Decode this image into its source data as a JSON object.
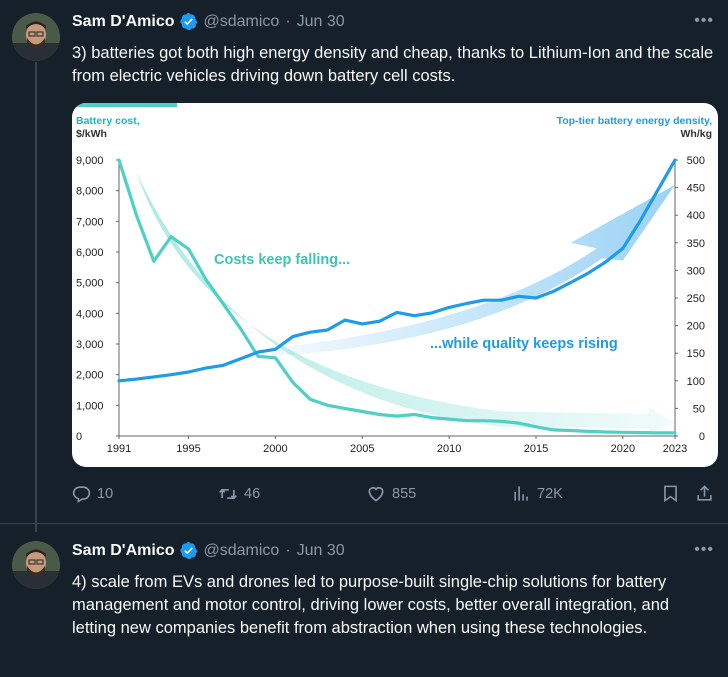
{
  "tweets": [
    {
      "author_name": "Sam D'Amico",
      "handle": "@sdamico",
      "separator": "·",
      "date": "Jun 30",
      "text": "3) batteries got both high energy density and cheap, thanks to Lithium-Ion and the scale from electric vehicles driving down battery cell costs.",
      "stats": {
        "replies": "10",
        "retweets": "46",
        "likes": "855",
        "views": "72K"
      }
    },
    {
      "author_name": "Sam D'Amico",
      "handle": "@sdamico",
      "separator": "·",
      "date": "Jun 30",
      "text": "4) scale from EVs and drones led to purpose-built single-chip solutions for battery management and motor control, driving lower costs, better overall integration, and letting new companies benefit from abstraction when using these technologies."
    }
  ],
  "icons": [
    "verified-badge-icon",
    "more-options-icon",
    "reply-icon",
    "retweet-icon",
    "like-icon",
    "views-icon",
    "bookmark-icon",
    "share-icon"
  ],
  "colors": {
    "background": "#15202b",
    "muted": "#8b98a5",
    "verified": "#1d9bf0",
    "cost_series": "#4fd0c4",
    "density_series": "#1e9be9"
  },
  "chart_data": {
    "type": "line",
    "left_axis_label": "Battery cost,",
    "left_axis_unit": "$/kWh",
    "right_axis_label": "Top-tier battery energy density,",
    "right_axis_unit": "Wh/kg",
    "xlim": [
      1991,
      2023
    ],
    "x_ticks": [
      "1991",
      "1995",
      "2000",
      "2005",
      "2010",
      "2015",
      "2020",
      "2023"
    ],
    "left_ylim": [
      0,
      9000
    ],
    "left_ticks": [
      "0",
      "1,000",
      "2,000",
      "3,000",
      "4,000",
      "5,000",
      "6,000",
      "7,000",
      "8,000",
      "9,000"
    ],
    "right_ylim": [
      0,
      500
    ],
    "right_ticks": [
      "0",
      "50",
      "100",
      "150",
      "200",
      "250",
      "300",
      "350",
      "400",
      "450",
      "500"
    ],
    "grid": false,
    "annotations": [
      "Costs keep falling...",
      "...while quality keeps rising"
    ],
    "series": [
      {
        "name": "Battery cost",
        "axis": "left",
        "points": [
          [
            1991,
            9000
          ],
          [
            1992,
            7200
          ],
          [
            1993,
            5700
          ],
          [
            1994,
            6500
          ],
          [
            1995,
            6100
          ],
          [
            1996,
            5100
          ],
          [
            1997,
            4300
          ],
          [
            1998,
            3500
          ],
          [
            1999,
            2600
          ],
          [
            2000,
            2550
          ],
          [
            2001,
            1750
          ],
          [
            2002,
            1200
          ],
          [
            2003,
            1000
          ],
          [
            2004,
            900
          ],
          [
            2005,
            800
          ],
          [
            2006,
            700
          ],
          [
            2007,
            650
          ],
          [
            2008,
            700
          ],
          [
            2009,
            600
          ],
          [
            2010,
            550
          ],
          [
            2011,
            500
          ],
          [
            2012,
            500
          ],
          [
            2013,
            480
          ],
          [
            2014,
            420
          ],
          [
            2015,
            300
          ],
          [
            2016,
            200
          ],
          [
            2017,
            180
          ],
          [
            2018,
            150
          ],
          [
            2019,
            130
          ],
          [
            2020,
            120
          ],
          [
            2021,
            110
          ],
          [
            2022,
            100
          ],
          [
            2023,
            100
          ]
        ]
      },
      {
        "name": "Top-tier battery energy density",
        "axis": "right",
        "points": [
          [
            1991,
            100
          ],
          [
            1992,
            103
          ],
          [
            1993,
            107
          ],
          [
            1994,
            111
          ],
          [
            1995,
            116
          ],
          [
            1996,
            123
          ],
          [
            1997,
            128
          ],
          [
            1998,
            140
          ],
          [
            1999,
            152
          ],
          [
            2000,
            157
          ],
          [
            2001,
            180
          ],
          [
            2002,
            188
          ],
          [
            2003,
            192
          ],
          [
            2004,
            210
          ],
          [
            2005,
            203
          ],
          [
            2006,
            208
          ],
          [
            2007,
            224
          ],
          [
            2008,
            218
          ],
          [
            2009,
            223
          ],
          [
            2010,
            233
          ],
          [
            2011,
            240
          ],
          [
            2012,
            246
          ],
          [
            2013,
            246
          ],
          [
            2014,
            253
          ],
          [
            2015,
            250
          ],
          [
            2016,
            262
          ],
          [
            2017,
            278
          ],
          [
            2018,
            295
          ],
          [
            2019,
            315
          ],
          [
            2020,
            340
          ],
          [
            2021,
            390
          ],
          [
            2022,
            445
          ],
          [
            2023,
            500
          ]
        ]
      }
    ]
  }
}
